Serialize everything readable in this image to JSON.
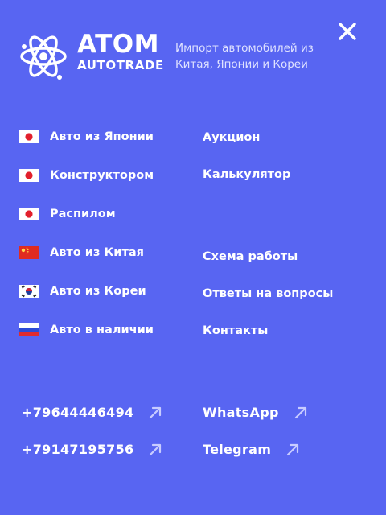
{
  "brand": {
    "name": "ATOM",
    "sub": "AUTOTRADE",
    "tagline": "Импорт автомобилей из Китая, Японии и Кореи"
  },
  "close_icon": "close-icon",
  "nav_left": [
    {
      "label": "Авто из Японии",
      "flag": "japan"
    },
    {
      "label": "Конструктором",
      "flag": "japan"
    },
    {
      "label": "Распилом",
      "flag": "japan"
    },
    {
      "label": "Авто из Китая",
      "flag": "china"
    },
    {
      "label": "Авто из Кореи",
      "flag": "korea"
    },
    {
      "label": "Авто в наличии",
      "flag": "russia"
    }
  ],
  "nav_right": [
    {
      "label": "Аукцион"
    },
    {
      "label": "Калькулятор"
    },
    {
      "label": "Схема работы"
    },
    {
      "label": "Ответы на вопросы"
    },
    {
      "label": "Контакты"
    }
  ],
  "contacts": {
    "phone1": "+79644446494",
    "phone2": "+79147195756",
    "whatsapp": "WhatsApp",
    "telegram": "Telegram"
  },
  "colors": {
    "background": "#5865f2",
    "text": "#ffffff",
    "tagline": "#dfe2ff",
    "arrow": "#c8ccff"
  }
}
